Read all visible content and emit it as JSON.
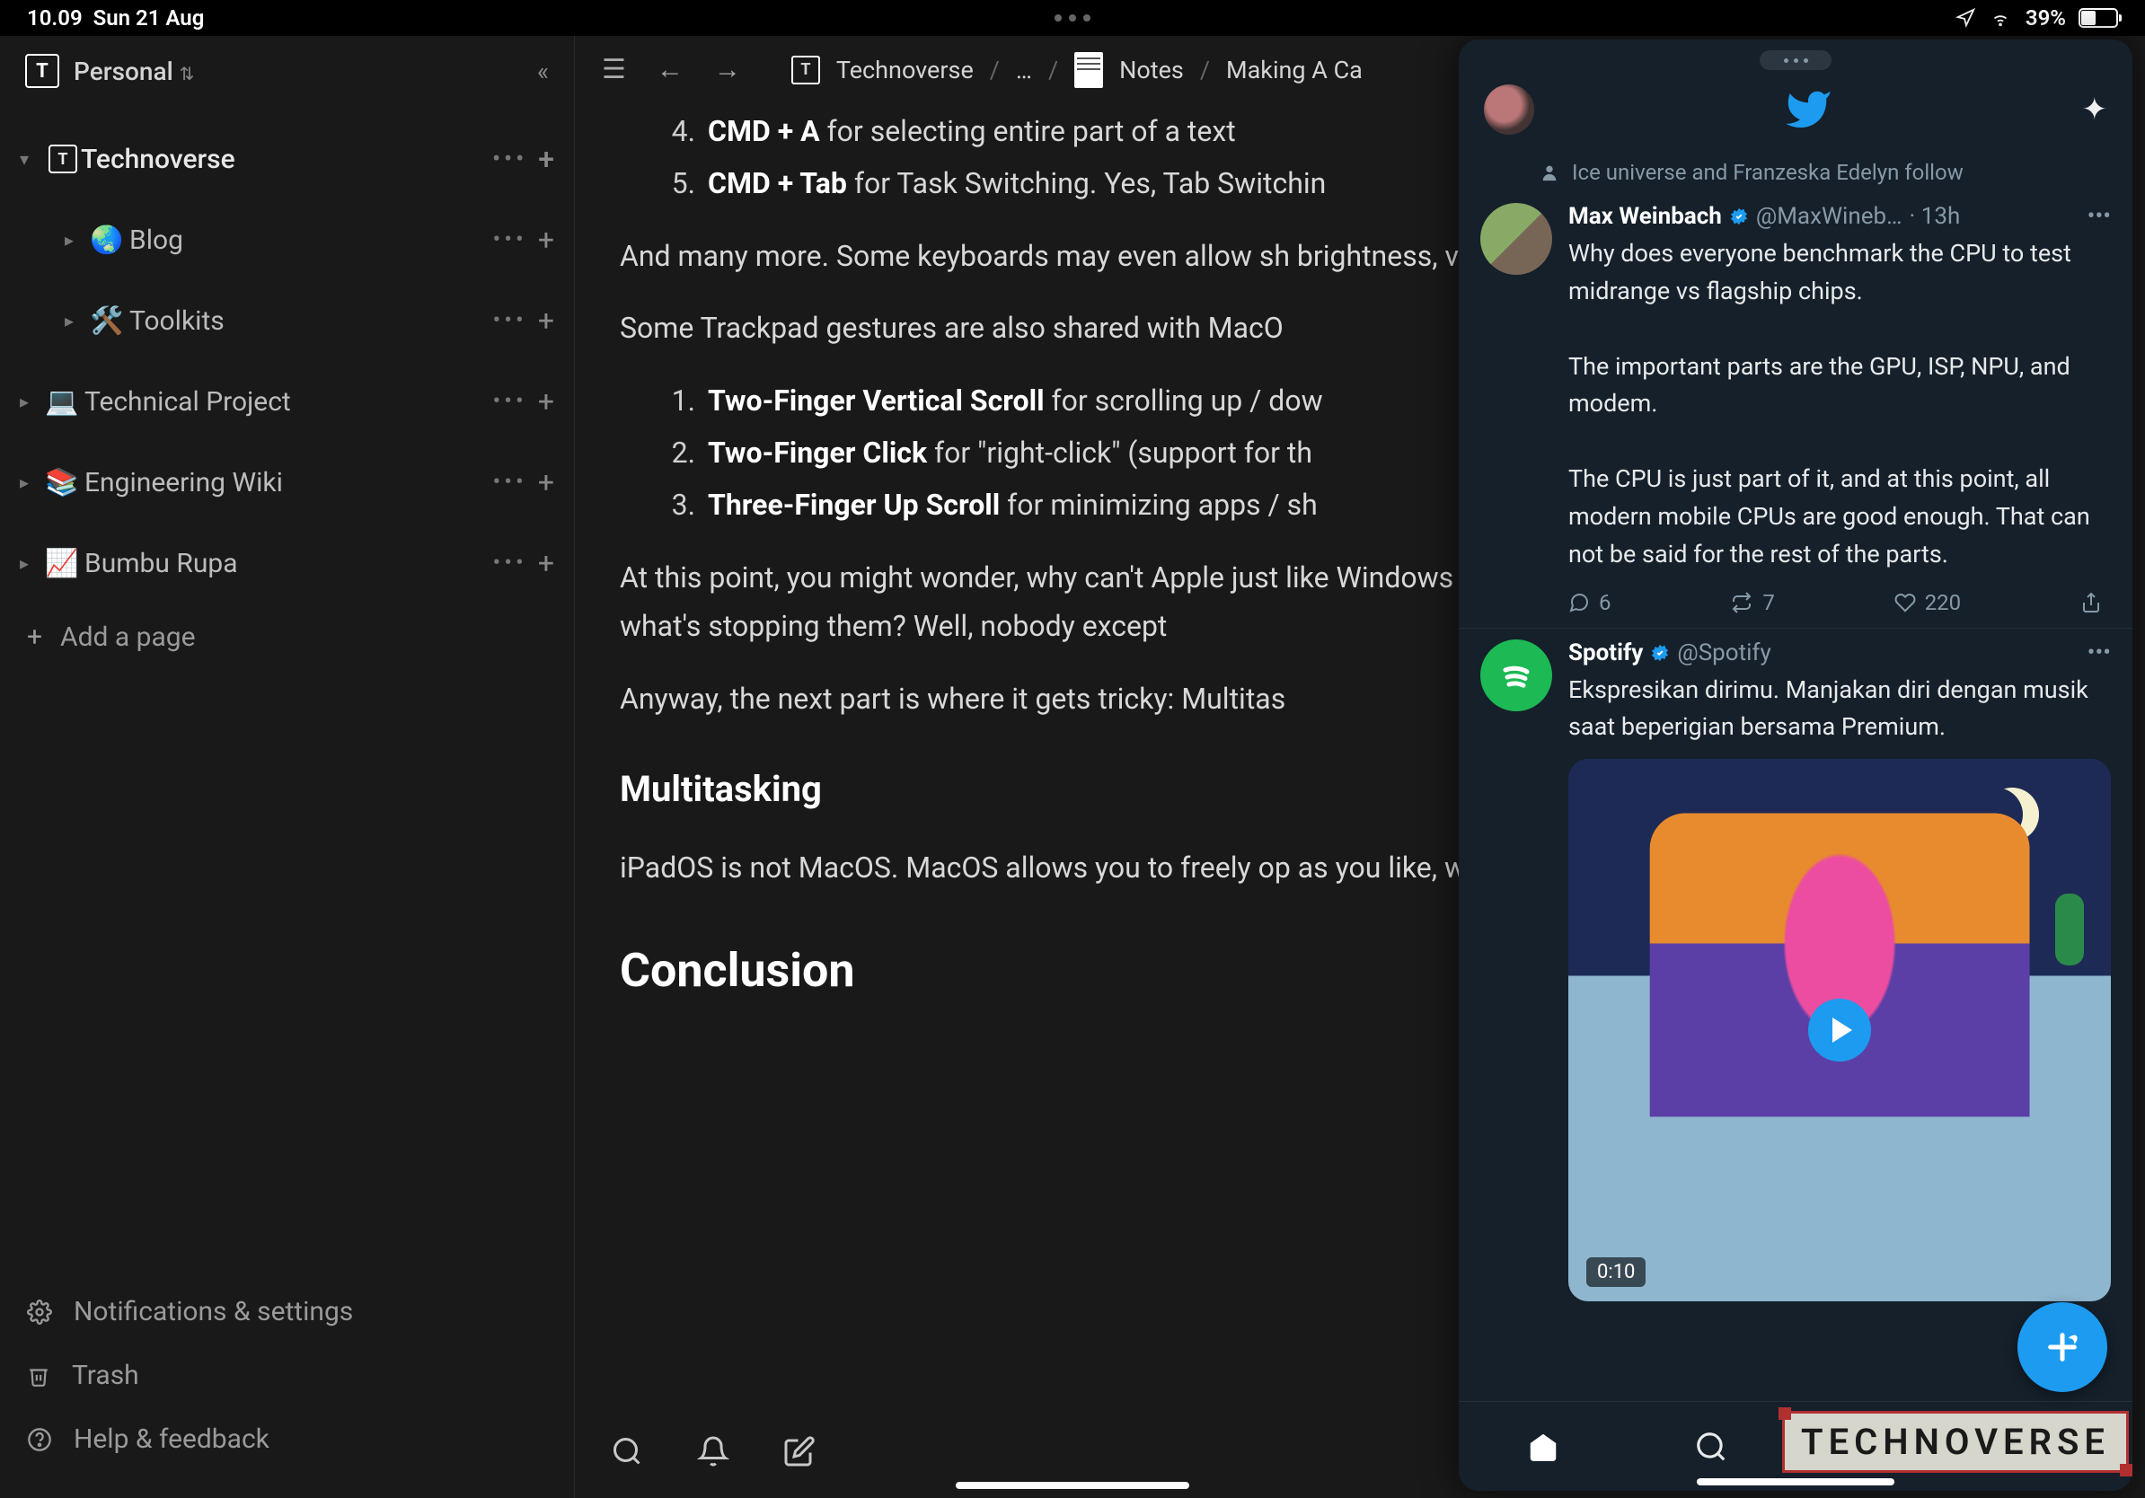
{
  "status": {
    "time": "10.09",
    "date": "Sun 21 Aug",
    "battery_pct": "39%"
  },
  "workspace": {
    "name": "Personal"
  },
  "sidebar": {
    "items": [
      {
        "label": "Technoverse",
        "icon": "T",
        "expanded": true
      },
      {
        "label": "Blog",
        "emoji": "🌏",
        "child": true
      },
      {
        "label": "Toolkits",
        "emoji": "🛠️",
        "child": true
      },
      {
        "label": "Technical Project",
        "emoji": "💻"
      },
      {
        "label": "Engineering Wiki",
        "emoji": "📚"
      },
      {
        "label": "Bumbu Rupa",
        "emoji": "📈"
      }
    ],
    "add_page": "Add a page",
    "notifications": "Notifications & settings",
    "trash": "Trash",
    "help": "Help & feedback"
  },
  "breadcrumbs": {
    "root": "Technoverse",
    "ellipsis": "…",
    "notes": "Notes",
    "current": "Making A Ca"
  },
  "doc": {
    "li4_num": "4.",
    "li4_bold": "CMD + A",
    "li4_rest": " for selecting entire part of a text",
    "li5_num": "5.",
    "li5_bold": "CMD + Tab",
    "li5_rest": " for Task Switching. Yes, Tab Switchin",
    "p1": "And many more. Some keyboards may even allow sh brightness, volume, quick return to home, and more.",
    "p2": "Some Trackpad gestures are also shared with MacO",
    "g1_num": "1.",
    "g1_bold": "Two-Finger Vertical Scroll",
    "g1_rest": " for scrolling up / dow",
    "g2_num": "2.",
    "g2_bold": "Two-Finger Click",
    "g2_rest": " for \"right-click\" (support for th",
    "g3_num": "3.",
    "g3_bold": "Three-Finger Up Scroll",
    "g3_rest": " for minimizing apps / sh",
    "p3": "At this point, you might wonder, why can't Apple just like Windows in its Surface lineup? They share the sa storage, what's stopping them? Well, nobody except",
    "p4": "Anyway, the next part is where it gets tricky: Multitas",
    "h2": "Multitasking",
    "p5": "iPadOS is not MacOS. MacOS allows you to freely op as you like, while iPadOS does not. Apple only allows",
    "h1": "Conclusion"
  },
  "twitter": {
    "follow_line": "Ice universe and Franzeska Edelyn follow",
    "t1": {
      "name": "Max Weinbach",
      "handle": "@MaxWineb…",
      "time": "· 13h",
      "body": "Why does everyone benchmark the CPU to test midrange vs flagship chips.\n\nThe important parts are the GPU, ISP, NPU, and modem.\n\nThe CPU is just part of it, and at this point, all modern mobile CPUs are good enough. That can not be said for the rest of the parts.",
      "replies": "6",
      "retweets": "7",
      "likes": "220"
    },
    "t2": {
      "name": "Spotify",
      "handle": "@Spotify",
      "body": "Ekspresikan dirimu. Manjakan diri dengan musik saat beperigian bersama Premium.",
      "duration": "0:10"
    }
  },
  "watermark": "TECHNOVERSE"
}
